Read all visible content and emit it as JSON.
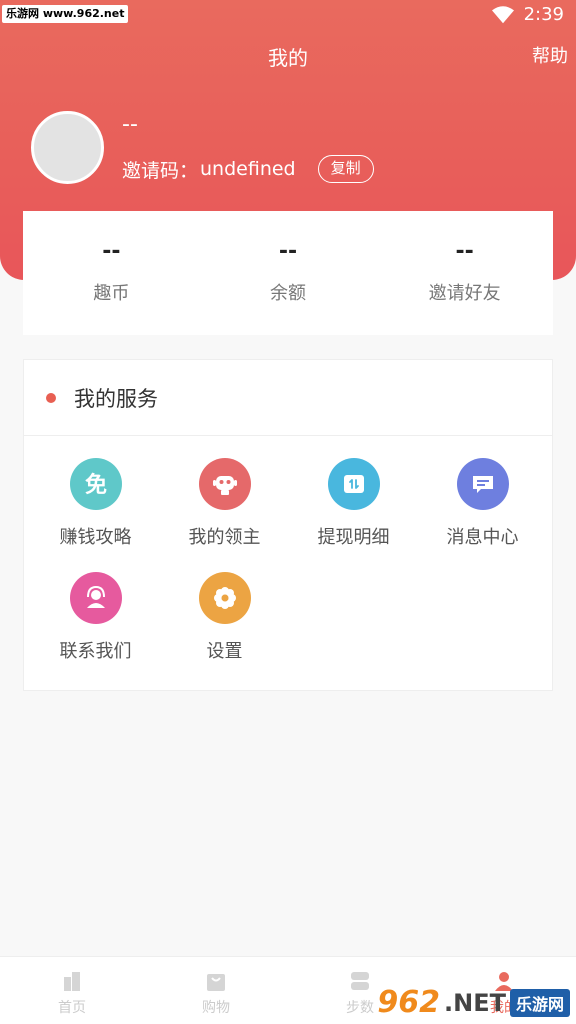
{
  "status_bar": {
    "watermark": "乐游网 www.962.net",
    "time": "2:39"
  },
  "header": {
    "title": "我的",
    "help": "帮助"
  },
  "profile": {
    "nickname": "--",
    "invite_label": "邀请码：",
    "invite_code": "undefined",
    "copy": "复制"
  },
  "stats": [
    {
      "value": "--",
      "label": "趣币"
    },
    {
      "value": "--",
      "label": "余额"
    },
    {
      "value": "--",
      "label": "邀请好友"
    }
  ],
  "services": {
    "title": "我的服务",
    "items": [
      {
        "label": "赚钱攻略",
        "icon": "free-icon",
        "color": "#5fc8c9"
      },
      {
        "label": "我的领主",
        "icon": "robot-icon",
        "color": "#e5696a"
      },
      {
        "label": "提现明细",
        "icon": "ticket-icon",
        "color": "#49b7de"
      },
      {
        "label": "消息中心",
        "icon": "message-icon",
        "color": "#6e7fdf"
      },
      {
        "label": "联系我们",
        "icon": "headset-icon",
        "color": "#e65a9e"
      },
      {
        "label": "设置",
        "icon": "gear-icon",
        "color": "#eca443"
      }
    ]
  },
  "tabs": [
    {
      "label": "首页",
      "icon": "home-icon"
    },
    {
      "label": "购物",
      "icon": "shopping-bag-icon"
    },
    {
      "label": "步数",
      "icon": "steps-icon"
    },
    {
      "label": "我的",
      "icon": "profile-icon"
    }
  ],
  "watermark_bottom": {
    "num": "962",
    "net": ".NET",
    "cn": "乐游网"
  },
  "colors": {
    "header_gradient_top": "#e96a5e",
    "header_gradient_bottom": "#e8565a",
    "accent_dot": "#e85f52"
  }
}
